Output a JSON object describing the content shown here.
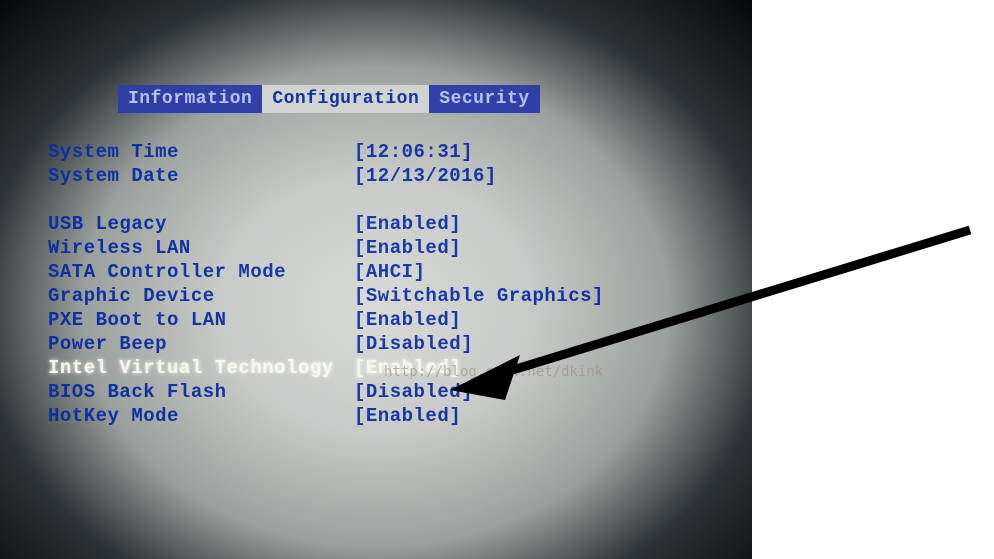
{
  "tabs": {
    "left": "Information",
    "active": "Configuration",
    "right": "Security"
  },
  "header": {
    "time_label": "System Time",
    "time_value": "[12:06:31]",
    "date_label": "System Date",
    "date_value": "[12/13/2016]"
  },
  "settings": [
    {
      "label": "USB Legacy",
      "value": "[Enabled]"
    },
    {
      "label": "Wireless LAN",
      "value": "[Enabled]"
    },
    {
      "label": "SATA Controller Mode",
      "value": "[AHCI]"
    },
    {
      "label": "Graphic Device",
      "value": "[Switchable Graphics]"
    },
    {
      "label": "PXE Boot to LAN",
      "value": "[Enabled]"
    },
    {
      "label": "Power Beep",
      "value": "[Disabled]"
    },
    {
      "label": "Intel Virtual Technology",
      "value": "[Enabled]",
      "highlight": true
    },
    {
      "label": "BIOS Back Flash",
      "value": "[Disabled]"
    },
    {
      "label": "HotKey Mode",
      "value": "[Enabled]"
    }
  ],
  "watermark": "http://blog.csdn.net/dkink"
}
